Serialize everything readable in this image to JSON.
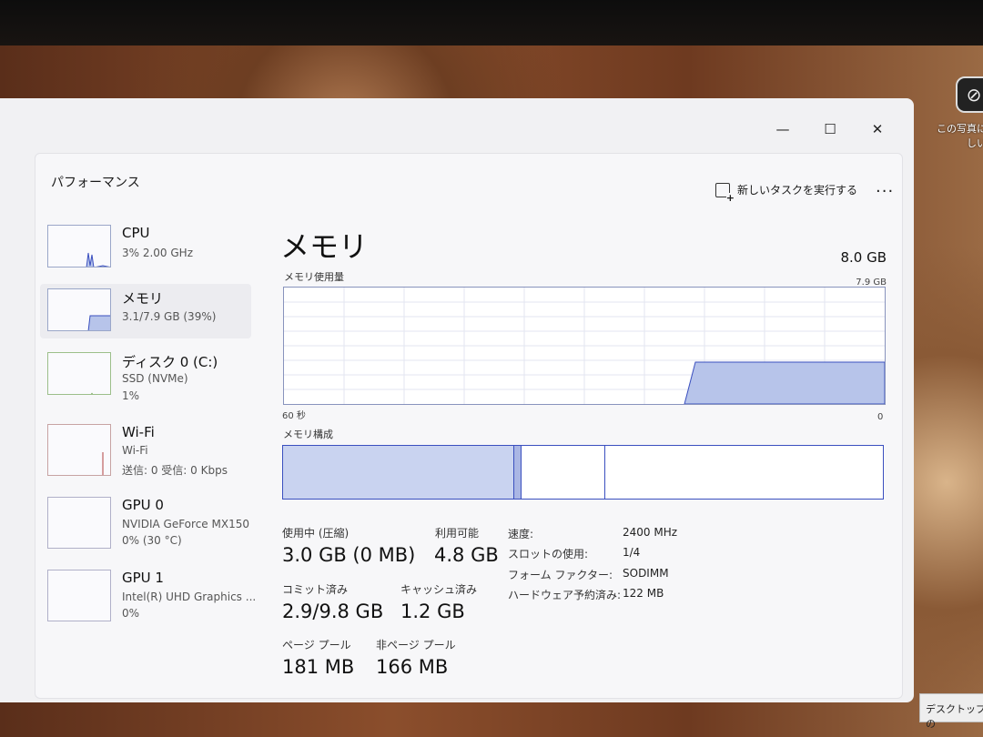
{
  "desktop": {
    "icon_caption": "この写真に\nしい",
    "tooltip": "デスクトップの"
  },
  "window": {
    "controls": {
      "minimize": "—",
      "maximize": "☐",
      "close": "✕"
    },
    "section_title": "パフォーマンス",
    "run_task_label": "新しいタスクを実行する",
    "more_label": "···"
  },
  "sidebar": {
    "items": [
      {
        "name": "CPU",
        "sub1": "3%  2.00 GHz",
        "sub2": ""
      },
      {
        "name": "メモリ",
        "sub1": "3.1/7.9 GB (39%)",
        "sub2": ""
      },
      {
        "name": "ディスク 0 (C:)",
        "sub1": "SSD (NVMe)",
        "sub2": "1%"
      },
      {
        "name": "Wi-Fi",
        "sub1": "Wi-Fi",
        "sub2": "送信: 0  受信: 0 Kbps"
      },
      {
        "name": "GPU 0",
        "sub1": "NVIDIA GeForce MX150",
        "sub2": "0%  (30 °C)"
      },
      {
        "name": "GPU 1",
        "sub1": "Intel(R) UHD Graphics ...",
        "sub2": "0%"
      }
    ]
  },
  "main": {
    "title": "メモリ",
    "total": "8.0 GB",
    "usage_graph": {
      "label": "メモリ使用量",
      "max_label": "7.9 GB",
      "axis_left": "60 秒",
      "axis_right": "0",
      "fill_color": "#b7c4ea",
      "line_color": "#3a4fbf"
    },
    "composition": {
      "label": "メモリ構成",
      "segments_fraction": {
        "in_use": 0.385,
        "modified": 0.012,
        "standby": 0.14
      }
    },
    "stats": {
      "in_use_label": "使用中 (圧縮)",
      "in_use_value": "3.0 GB (0 MB)",
      "available_label": "利用可能",
      "available_value": "4.8 GB",
      "committed_label": "コミット済み",
      "committed_value": "2.9/9.8 GB",
      "cached_label": "キャッシュ済み",
      "cached_value": "1.2 GB",
      "paged_pool_label": "ページ プール",
      "paged_pool_value": "181 MB",
      "nonpaged_pool_label": "非ページ プール",
      "nonpaged_pool_value": "166 MB"
    },
    "details": {
      "speed_label": "速度:",
      "speed_value": "2400 MHz",
      "slots_label": "スロットの使用:",
      "slots_value": "1/4",
      "form_label": "フォーム ファクター:",
      "form_value": "SODIMM",
      "reserved_label": "ハードウェア予約済み:",
      "reserved_value": "122 MB"
    }
  }
}
